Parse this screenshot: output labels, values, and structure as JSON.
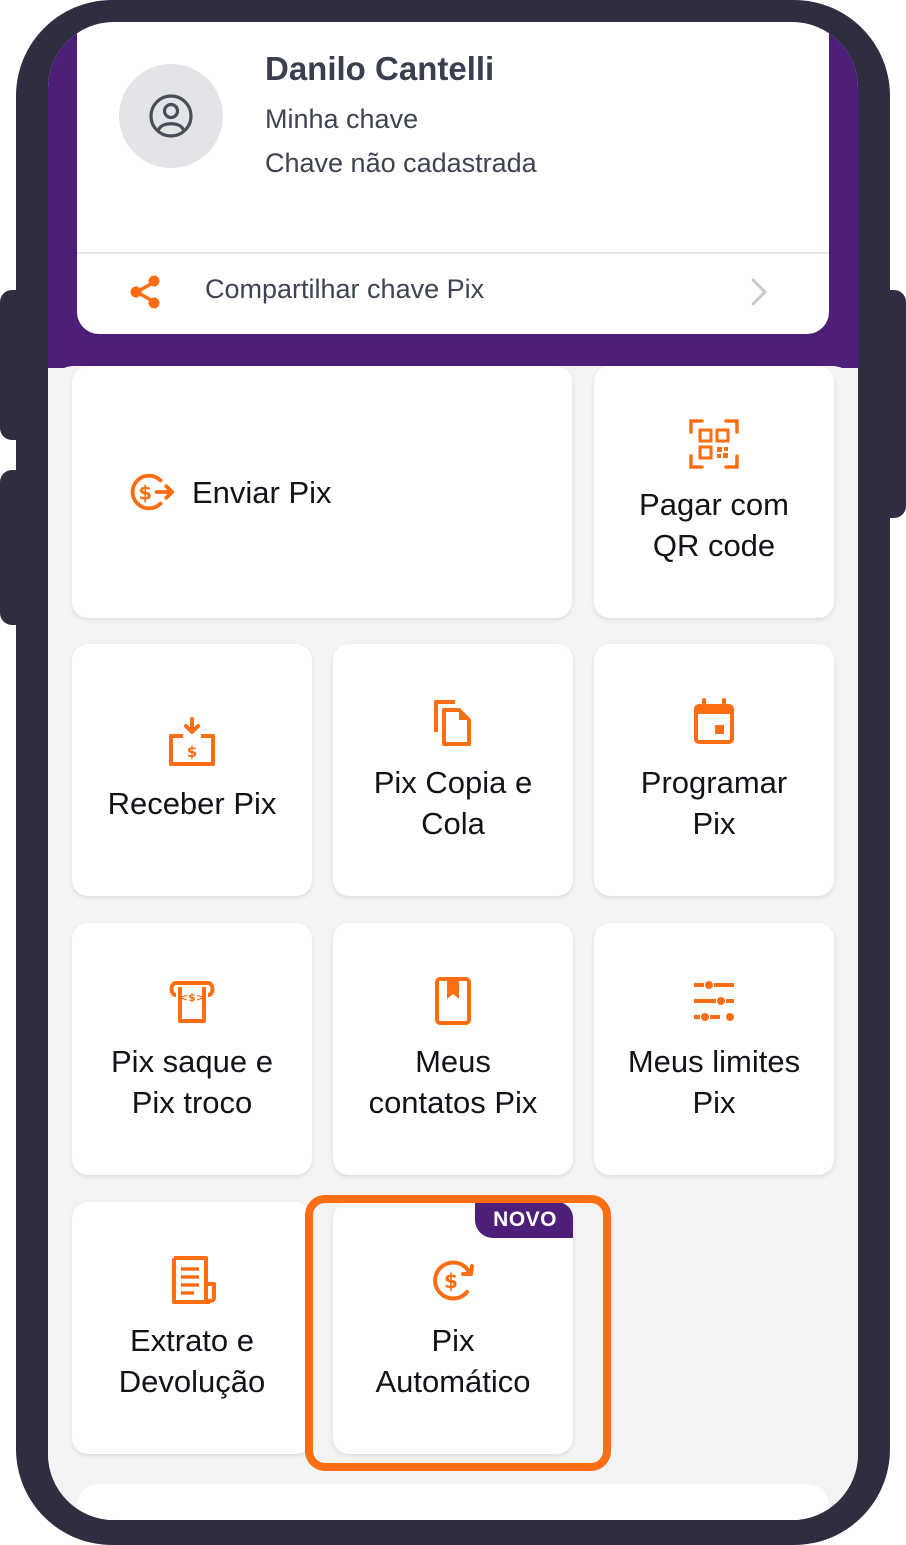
{
  "profile": {
    "name": "Danilo Cantelli",
    "key_label": "Minha chave",
    "key_status": "Chave não cadastrada"
  },
  "share": {
    "label": "Compartilhar chave Pix"
  },
  "tiles": {
    "send": "Enviar Pix",
    "qr_1": "Pagar com",
    "qr_2": "QR code",
    "receive": "Receber Pix",
    "copy_1": "Pix Copia e",
    "copy_2": "Cola",
    "schedule_1": "Programar",
    "schedule_2": "Pix",
    "withdraw_1": "Pix saque e",
    "withdraw_2": "Pix troco",
    "contacts_1": "Meus",
    "contacts_2": "contatos Pix",
    "limits_1": "Meus limites",
    "limits_2": "Pix",
    "statement_1": "Extrato e",
    "statement_2": "Devolução",
    "auto_1": "Pix",
    "auto_2": "Automático",
    "auto_badge": "NOVO"
  },
  "colors": {
    "accent": "#fd6d12",
    "brand_purple": "#4d1f78",
    "frame": "#2f2e41",
    "text": "#111318"
  },
  "icons": {
    "avatar": "user-circle-icon",
    "share": "share-icon",
    "chevron": "chevron-right-icon",
    "send": "send-money-icon",
    "qr": "qr-code-icon",
    "receive": "receive-money-icon",
    "copy": "copy-icon",
    "schedule": "calendar-icon",
    "withdraw": "cash-withdraw-icon",
    "contacts": "contacts-book-icon",
    "limits": "sliders-icon",
    "statement": "receipt-icon",
    "auto": "auto-payment-icon"
  }
}
